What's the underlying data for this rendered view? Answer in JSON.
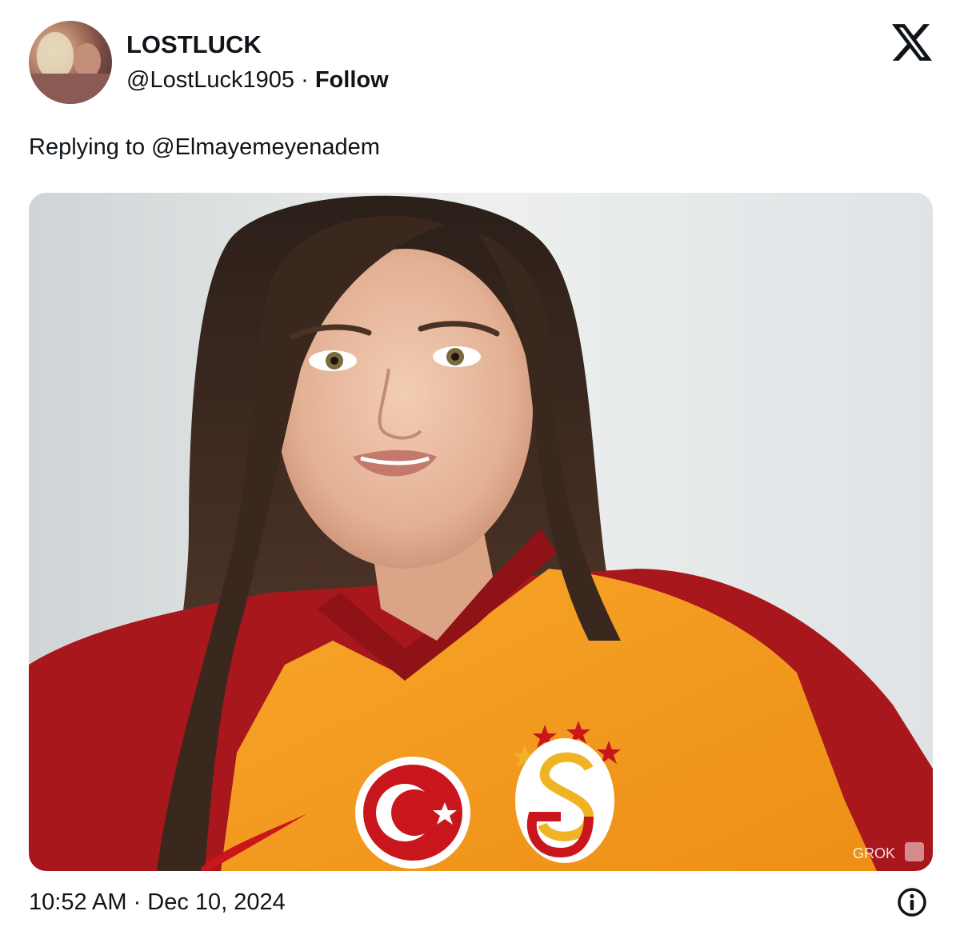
{
  "tweet": {
    "author": {
      "display_name": "LOSTLUCK",
      "handle": "@LostLuck1905",
      "separator": "·",
      "follow_label": "Follow",
      "avatar_icon": "user-avatar"
    },
    "reply_to": "Replying to @Elmayemeyenadem",
    "image": {
      "description_icon": "photo",
      "watermark": "GROK"
    },
    "timestamp": "10:52 AM · Dec 10, 2024",
    "platform_icon": "x-logo-icon",
    "info_icon": "info-icon"
  },
  "colors": {
    "text": "#0f1419",
    "jersey_orange": "#f39c1f",
    "jersey_red": "#a8171c",
    "background": "#ffffff"
  }
}
